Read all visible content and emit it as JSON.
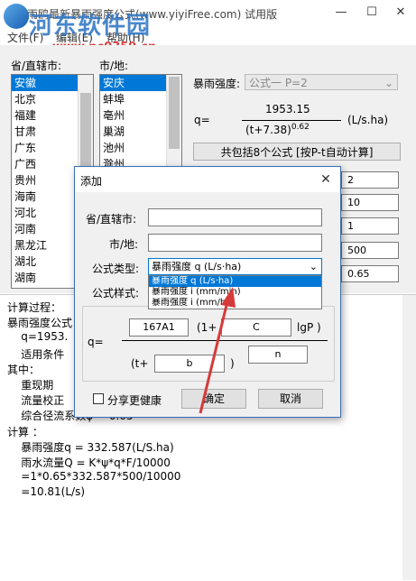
{
  "window": {
    "title": "雨鸥最新暴雨强度公式(www.yiyiFree.com) 试用版",
    "minimize_icon": "minimize-icon",
    "maximize_icon": "maximize-icon",
    "close_icon": "close-icon"
  },
  "watermark": {
    "text": "河东软件园",
    "url": "www.pc0359.cn"
  },
  "menu": {
    "items": [
      "文件(F)",
      "编辑(E)",
      "帮助(H)"
    ]
  },
  "province": {
    "label": "省/直辖市:",
    "items": [
      "安徽",
      "北京",
      "福建",
      "甘肃",
      "广东",
      "广西",
      "贵州",
      "海南",
      "河北",
      "河南",
      "黑龙江",
      "湖北",
      "湖南"
    ],
    "selected": "安徽"
  },
  "city": {
    "label": "市/地:",
    "items": [
      "安庆",
      "蚌埠",
      "亳州",
      "巢湖",
      "池州",
      "滁州"
    ],
    "selected": "安庆"
  },
  "intensity": {
    "label": "暴雨强度:",
    "selected": "公式一 P=2",
    "formula_q": "q=",
    "numerator": "1953.15",
    "denominator": "(t+7.38)",
    "exponent": "0.62",
    "unit": "(L/s.ha)",
    "auto_calc_label": "共包括8个公式 [按P-t自动计算]"
  },
  "right_values": [
    "2",
    "10",
    "1",
    "500",
    "0.65"
  ],
  "results": {
    "lines": [
      "计算过程：",
      "暴雨强度公式",
      "    q=1953.",
      "    适用条件",
      "其中：",
      "    重现期",
      "    流量校正",
      "    综合径流系数ψ = 0.65",
      "计算 ：",
      "    暴雨强度q = 332.587(L/S.ha)",
      "    雨水流量Q = K*ψ*q*F/10000",
      "    =1*0.65*332.587*500/10000",
      "    =10.81(L/s)"
    ]
  },
  "dialog": {
    "title": "添加",
    "province_label": "省/直辖市:",
    "city_label": "市/地:",
    "type_label": "公式类型:",
    "type_selected": "暴雨强度 q (L/s·ha)",
    "type_options": [
      "暴雨强度 q (L/s·ha)",
      "暴雨强度 i (mm/min)",
      "暴雨强度 i (mm/h)"
    ],
    "style_label": "公式样式:",
    "formula": {
      "A1": "167A1",
      "one_plus": "(1+",
      "C": "C",
      "lgP": "lgP )",
      "q_eq": "q=",
      "n": "n",
      "t_plus": "(t+",
      "b": "b",
      "close_paren": ")"
    },
    "share_label": "分享更健康",
    "ok_label": "确定",
    "cancel_label": "取消"
  },
  "colors": {
    "selection": "#0078d7",
    "arrow": "#d63a3a"
  }
}
